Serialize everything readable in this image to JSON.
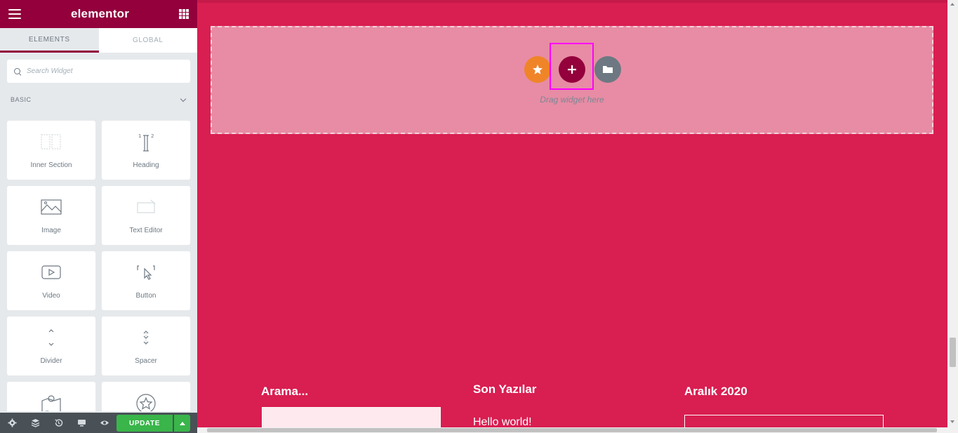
{
  "header": {
    "logo": "elementor"
  },
  "tabs": [
    {
      "label": "ELEMENTS",
      "active": true
    },
    {
      "label": "GLOBAL",
      "active": false
    }
  ],
  "search": {
    "placeholder": "Search Widget",
    "value": ""
  },
  "category": {
    "label": "BASIC",
    "expanded": true
  },
  "widgets": [
    {
      "label": "Inner Section",
      "icon": "columns-icon"
    },
    {
      "label": "Heading",
      "icon": "heading-icon"
    },
    {
      "label": "Image",
      "icon": "image-icon"
    },
    {
      "label": "Text Editor",
      "icon": "text-editor-icon"
    },
    {
      "label": "Video",
      "icon": "video-icon"
    },
    {
      "label": "Button",
      "icon": "button-icon"
    },
    {
      "label": "Divider",
      "icon": "divider-icon"
    },
    {
      "label": "Spacer",
      "icon": "spacer-icon"
    },
    {
      "label": "",
      "icon": "google-maps-icon"
    },
    {
      "label": "",
      "icon": "star-icon"
    }
  ],
  "footer": {
    "icons": [
      "settings-icon",
      "navigator-icon",
      "history-icon",
      "responsive-icon",
      "preview-icon"
    ],
    "update_label": "UPDATE"
  },
  "canvas": {
    "drop_text": "Drag widget here",
    "footer_widgets": {
      "search_title": "Arama...",
      "recent_title": "Son Yazılar",
      "recent_first": "Hello world!",
      "calendar_title": "Aralık 2020"
    }
  },
  "colors": {
    "brand": "#93003c",
    "canvas_bg": "#d91e51",
    "dropzone_bg": "#e78ca4",
    "template_button": "#f08429",
    "add_button": "#93003c",
    "folder_button": "#6d7882",
    "update_button": "#39b54a",
    "highlight": "#ff00ff"
  }
}
